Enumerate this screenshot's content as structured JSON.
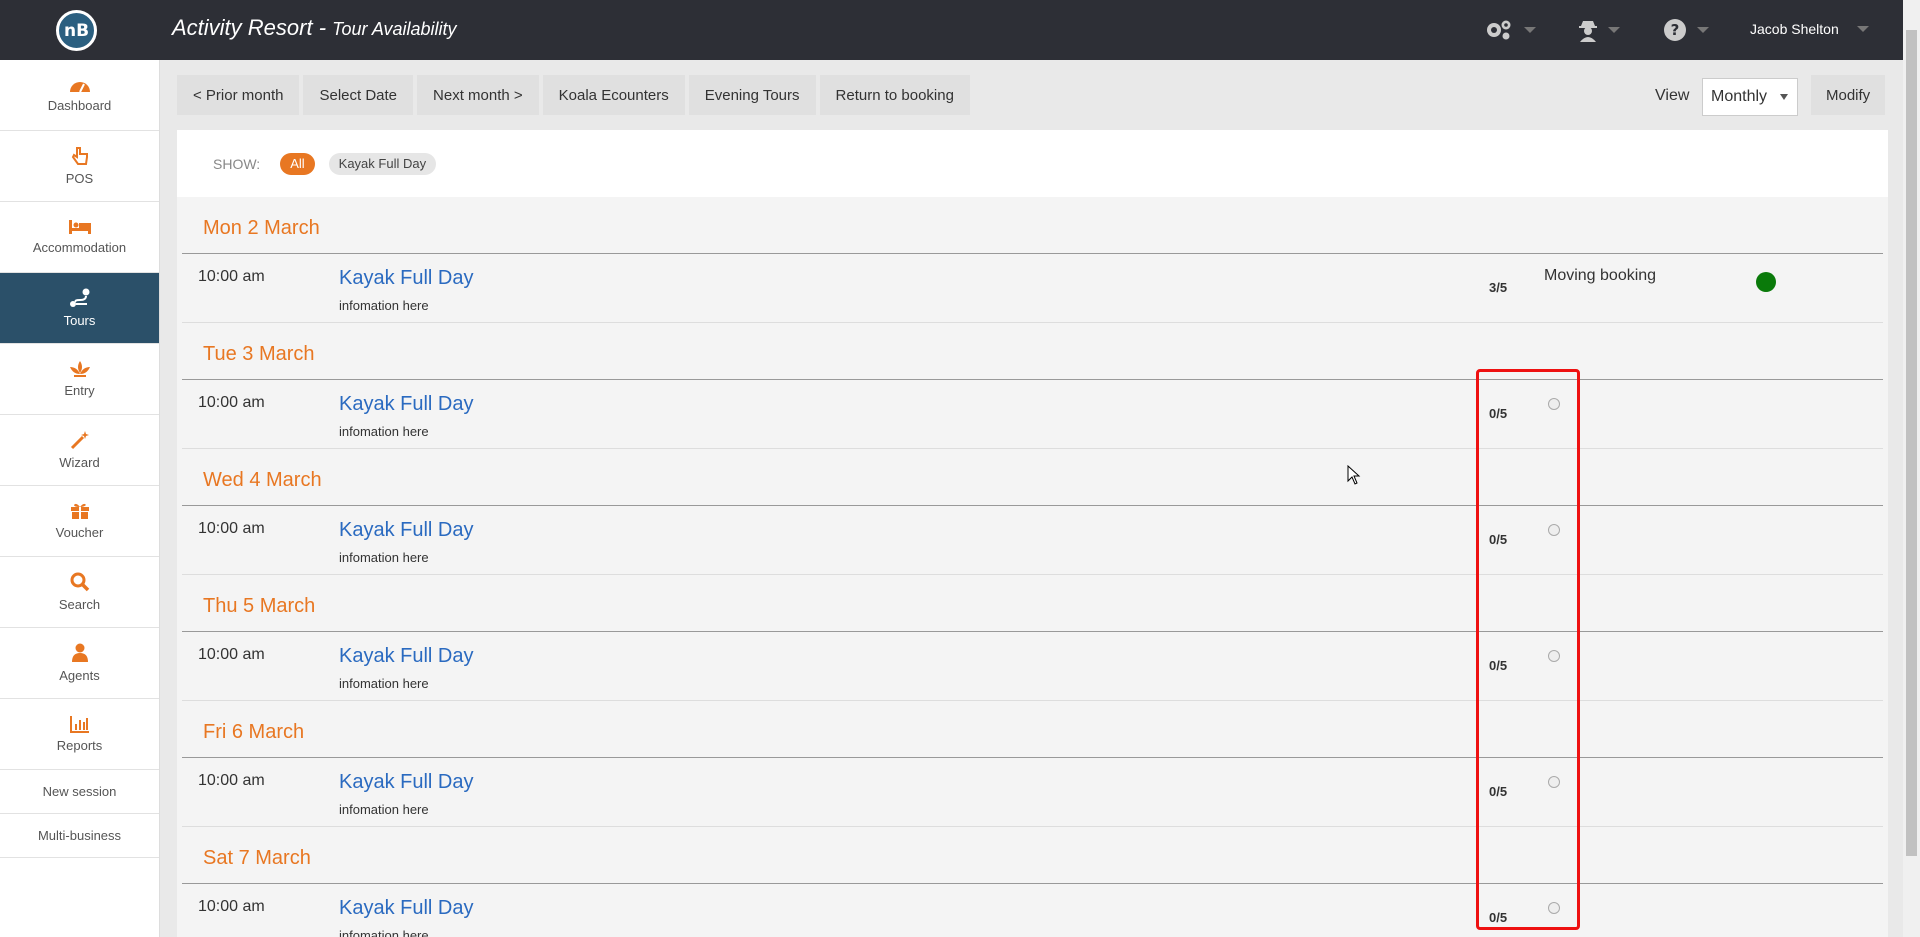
{
  "header": {
    "logo_text": "nB",
    "app_title": "Activity Resort - ",
    "page_subtitle": "Tour Availability",
    "user_name": "Jacob Shelton"
  },
  "sidebar": {
    "items": [
      {
        "label": "Dashboard",
        "icon": "dashboard-icon"
      },
      {
        "label": "POS",
        "icon": "pointer-hand-icon"
      },
      {
        "label": "Accommodation",
        "icon": "bed-icon"
      },
      {
        "label": "Tours",
        "icon": "route-icon",
        "active": true
      },
      {
        "label": "Entry",
        "icon": "lotus-icon"
      },
      {
        "label": "Wizard",
        "icon": "magic-wand-icon"
      },
      {
        "label": "Voucher",
        "icon": "gift-icon"
      },
      {
        "label": "Search",
        "icon": "search-icon"
      },
      {
        "label": "Agents",
        "icon": "user-icon"
      },
      {
        "label": "Reports",
        "icon": "bar-chart-icon"
      }
    ],
    "text_links": [
      "New session",
      "Multi-business"
    ]
  },
  "toolbar": {
    "buttons": [
      "< Prior month",
      "Select Date",
      "Next month >",
      "Koala Ecounters",
      "Evening Tours",
      "Return to booking"
    ],
    "view_label": "View",
    "view_value": "Monthly",
    "modify_label": "Modify"
  },
  "filter": {
    "show_label": "SHOW:",
    "pills": [
      "All",
      "Kayak Full Day"
    ]
  },
  "days": [
    {
      "date": "Mon 2 March",
      "time": "10:00 am",
      "tour": "Kayak Full Day",
      "info": "infomation here",
      "count": "3/5",
      "status": "Moving booking",
      "selected": true
    },
    {
      "date": "Tue 3 March",
      "time": "10:00 am",
      "tour": "Kayak Full Day",
      "info": "infomation here",
      "count": "0/5"
    },
    {
      "date": "Wed 4 March",
      "time": "10:00 am",
      "tour": "Kayak Full Day",
      "info": "infomation here",
      "count": "0/5"
    },
    {
      "date": "Thu 5 March",
      "time": "10:00 am",
      "tour": "Kayak Full Day",
      "info": "infomation here",
      "count": "0/5"
    },
    {
      "date": "Fri 6 March",
      "time": "10:00 am",
      "tour": "Kayak Full Day",
      "info": "infomation here",
      "count": "0/5"
    },
    {
      "date": "Sat 7 March",
      "time": "10:00 am",
      "tour": "Kayak Full Day",
      "info": "infomation here",
      "count": "0/5"
    }
  ],
  "colors": {
    "accent": "#e87722",
    "topbar": "#2d2f36",
    "active_nav": "#2b5069",
    "link": "#2a6ac0",
    "status_green": "#0a7a0a",
    "highlight": "#ee1111"
  }
}
